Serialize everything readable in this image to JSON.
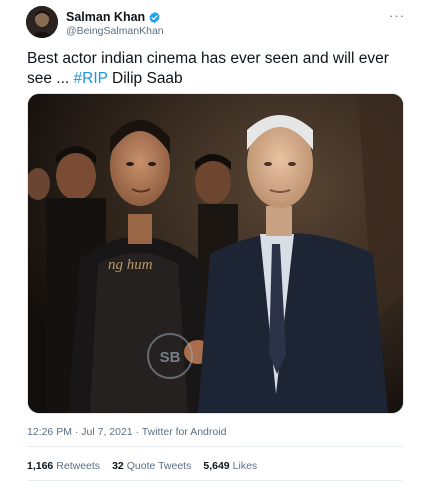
{
  "tweet": {
    "author_name": "Salman Khan",
    "author_handle": "@BeingSalmanKhan",
    "more_label": "···",
    "text_main": "Best actor indian cinema has ever seen and will ever see ... ",
    "hashtag": "#RIP",
    "text_tail": " Dilip Saab",
    "timestamp": "12:26 PM · Jul 7, 2021 · Twitter for Android",
    "photo_watermark": "SB"
  },
  "stats": {
    "retweets_count": "1,166",
    "retweets_label": "Retweets",
    "quotes_count": "32",
    "quotes_label": "Quote Tweets",
    "likes_count": "5,649",
    "likes_label": "Likes"
  },
  "colors": {
    "link": "#1b95e0",
    "verified": "#1da1f2",
    "secondary_text": "#5b7083",
    "divider": "#e6ecf0"
  },
  "icons": {
    "verified": "verified-badge-icon",
    "more": "more-options-icon"
  }
}
